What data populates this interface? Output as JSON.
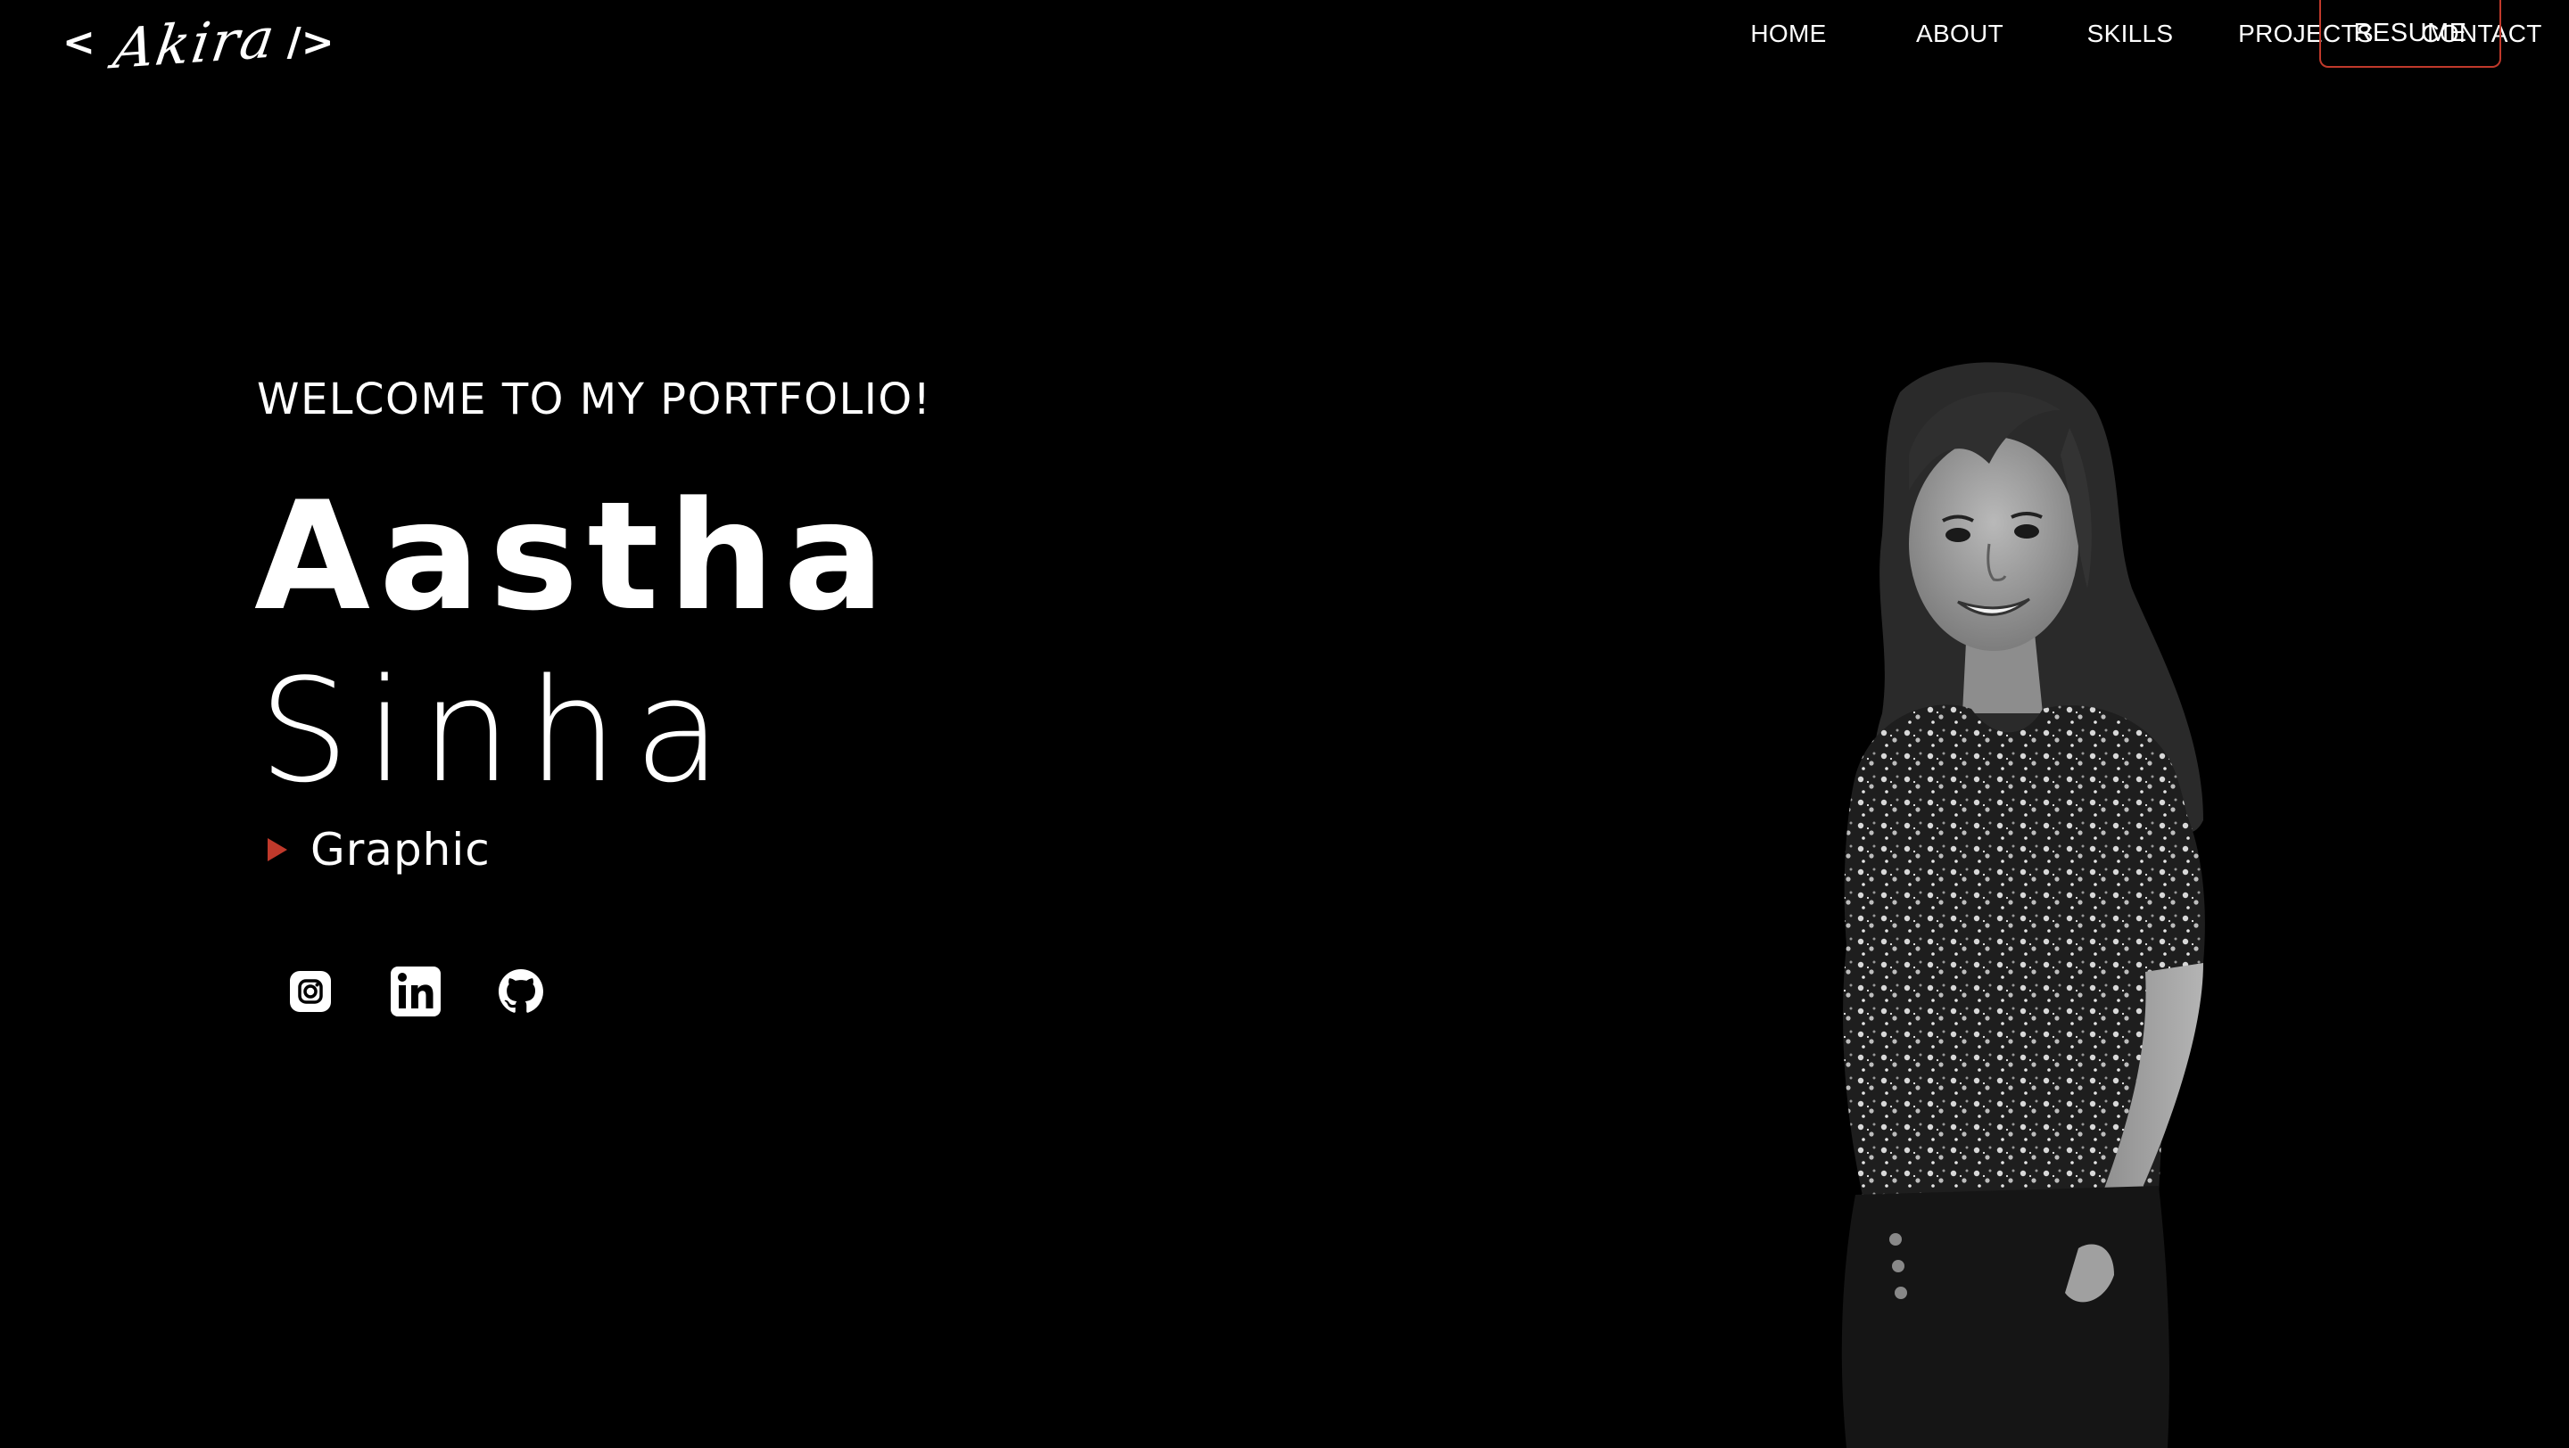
{
  "logo": {
    "open": "<",
    "signature": "Akira",
    "close": "/>"
  },
  "nav": {
    "items": [
      {
        "label": "HOME"
      },
      {
        "label": "ABOUT"
      },
      {
        "label": "SKILLS"
      },
      {
        "label": "PROJECTS"
      },
      {
        "label": "CONTACT"
      }
    ],
    "resume_label": "RESUME"
  },
  "hero": {
    "welcome": "WELCOME TO MY PORTFOLIO!",
    "first_name": "Aastha",
    "last_name": "Sinha",
    "role": "Graphic"
  },
  "socials": [
    {
      "icon": "instagram-icon"
    },
    {
      "icon": "linkedin-icon"
    },
    {
      "icon": "github-icon"
    }
  ],
  "colors": {
    "background": "#000000",
    "text": "#ffffff",
    "accent": "#c0392b"
  }
}
